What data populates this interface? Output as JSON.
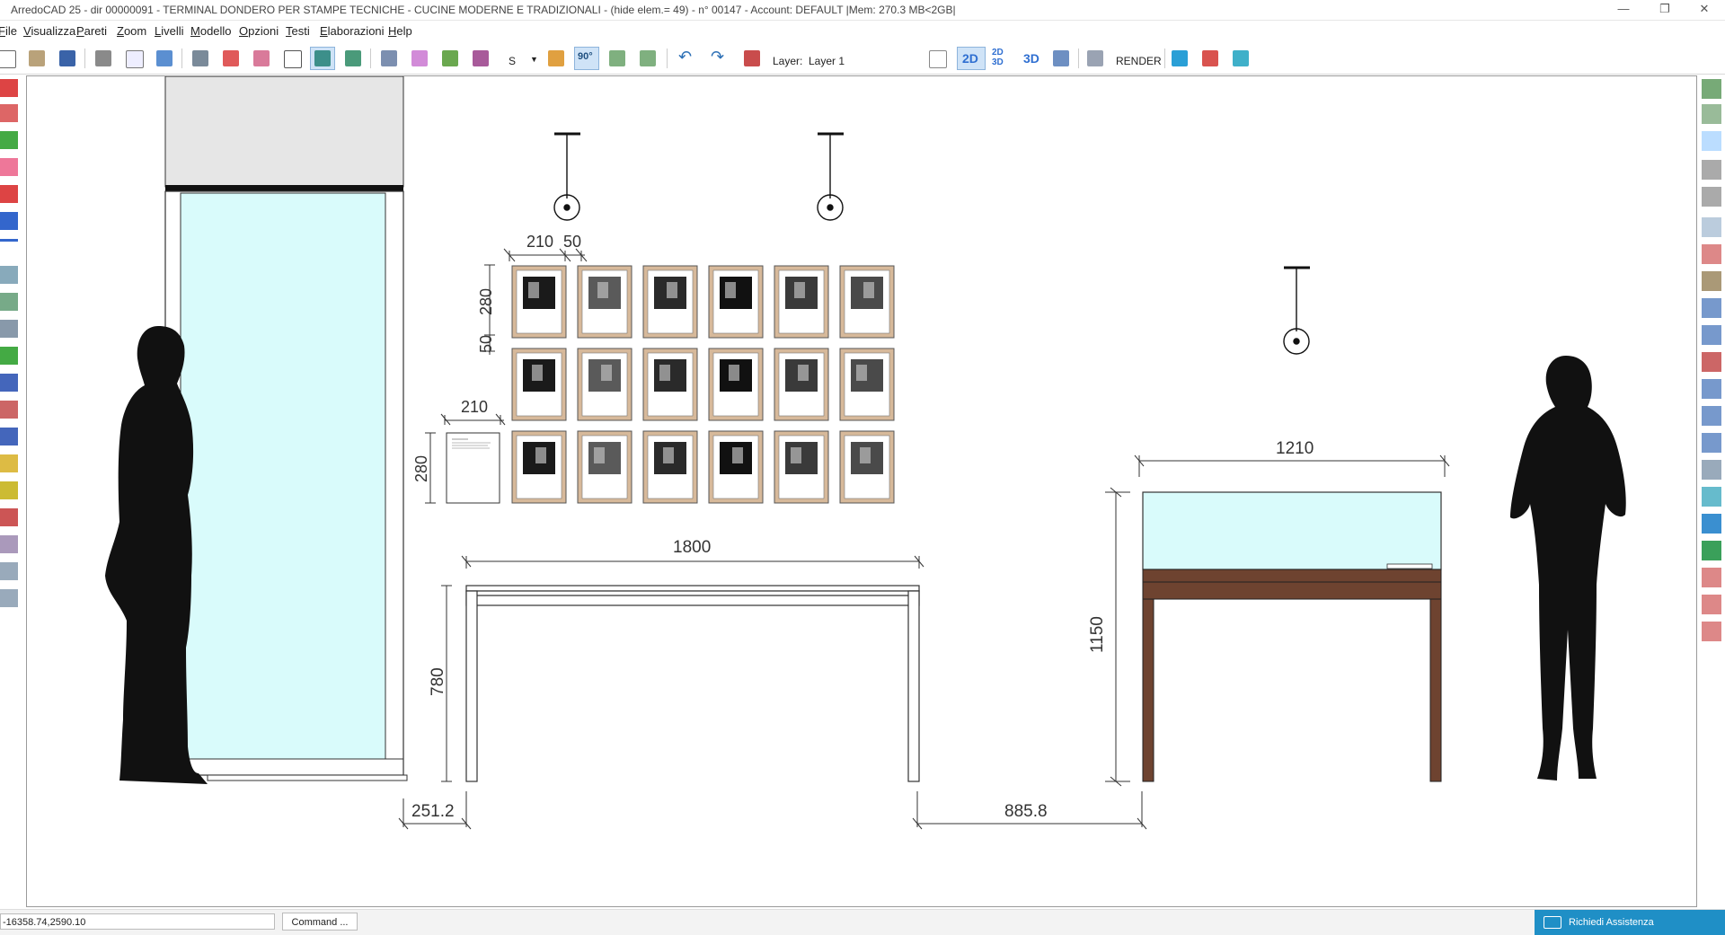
{
  "window": {
    "title": "ArredoCAD 25 - dir 00000091 - TERMINAL DONDERO PER STAMPE TECNICHE - CUCINE MODERNE E TRADIZIONALI - (hide elem.= 49)  - n° 00147 - Account: DEFAULT      |Mem: 270.3 MB<2GB|",
    "minimize": "—",
    "maximize": "❐",
    "close": "✕"
  },
  "menu": [
    "File",
    "Visualizza",
    "Pareti",
    "Zoom",
    "Livelli",
    "Modello",
    "Opzioni",
    "Testi",
    "Elaborazioni",
    "Help"
  ],
  "toolbar": {
    "s_label": "S",
    "angle_label": "90°",
    "layer_label": "Layer:",
    "layer_value": "Layer 1",
    "view_2d": "2D",
    "view_2d3d_top": "2D",
    "view_2d3d_bottom": "3D",
    "view_3d": "3D",
    "render_label": "RENDER",
    "active_view": "2D"
  },
  "drawing": {
    "dim_frame_width": "210",
    "dim_frame_gap": "50",
    "dim_frame_height": "280",
    "dim_row_gap": "50",
    "dim_panel_width": "210",
    "dim_panel_height": "280",
    "dim_table_length": "1800",
    "dim_table_height": "780",
    "dim_left_offset": "251.2",
    "dim_between": "885.8",
    "dim_vitrine_width": "1210",
    "dim_vitrine_height": "1150",
    "frame_rows": 3,
    "frame_cols": 6
  },
  "status": {
    "coordinates": "-16358.74,2590.10",
    "command_button": "Command ...",
    "assist_label": "Richiedi Assistenza"
  },
  "colors": {
    "glass": "#d9fbfb",
    "frame_wood": "#d7b99a",
    "vitrine_wood": "#6e4330",
    "accent_blue": "#1f8fc6"
  }
}
